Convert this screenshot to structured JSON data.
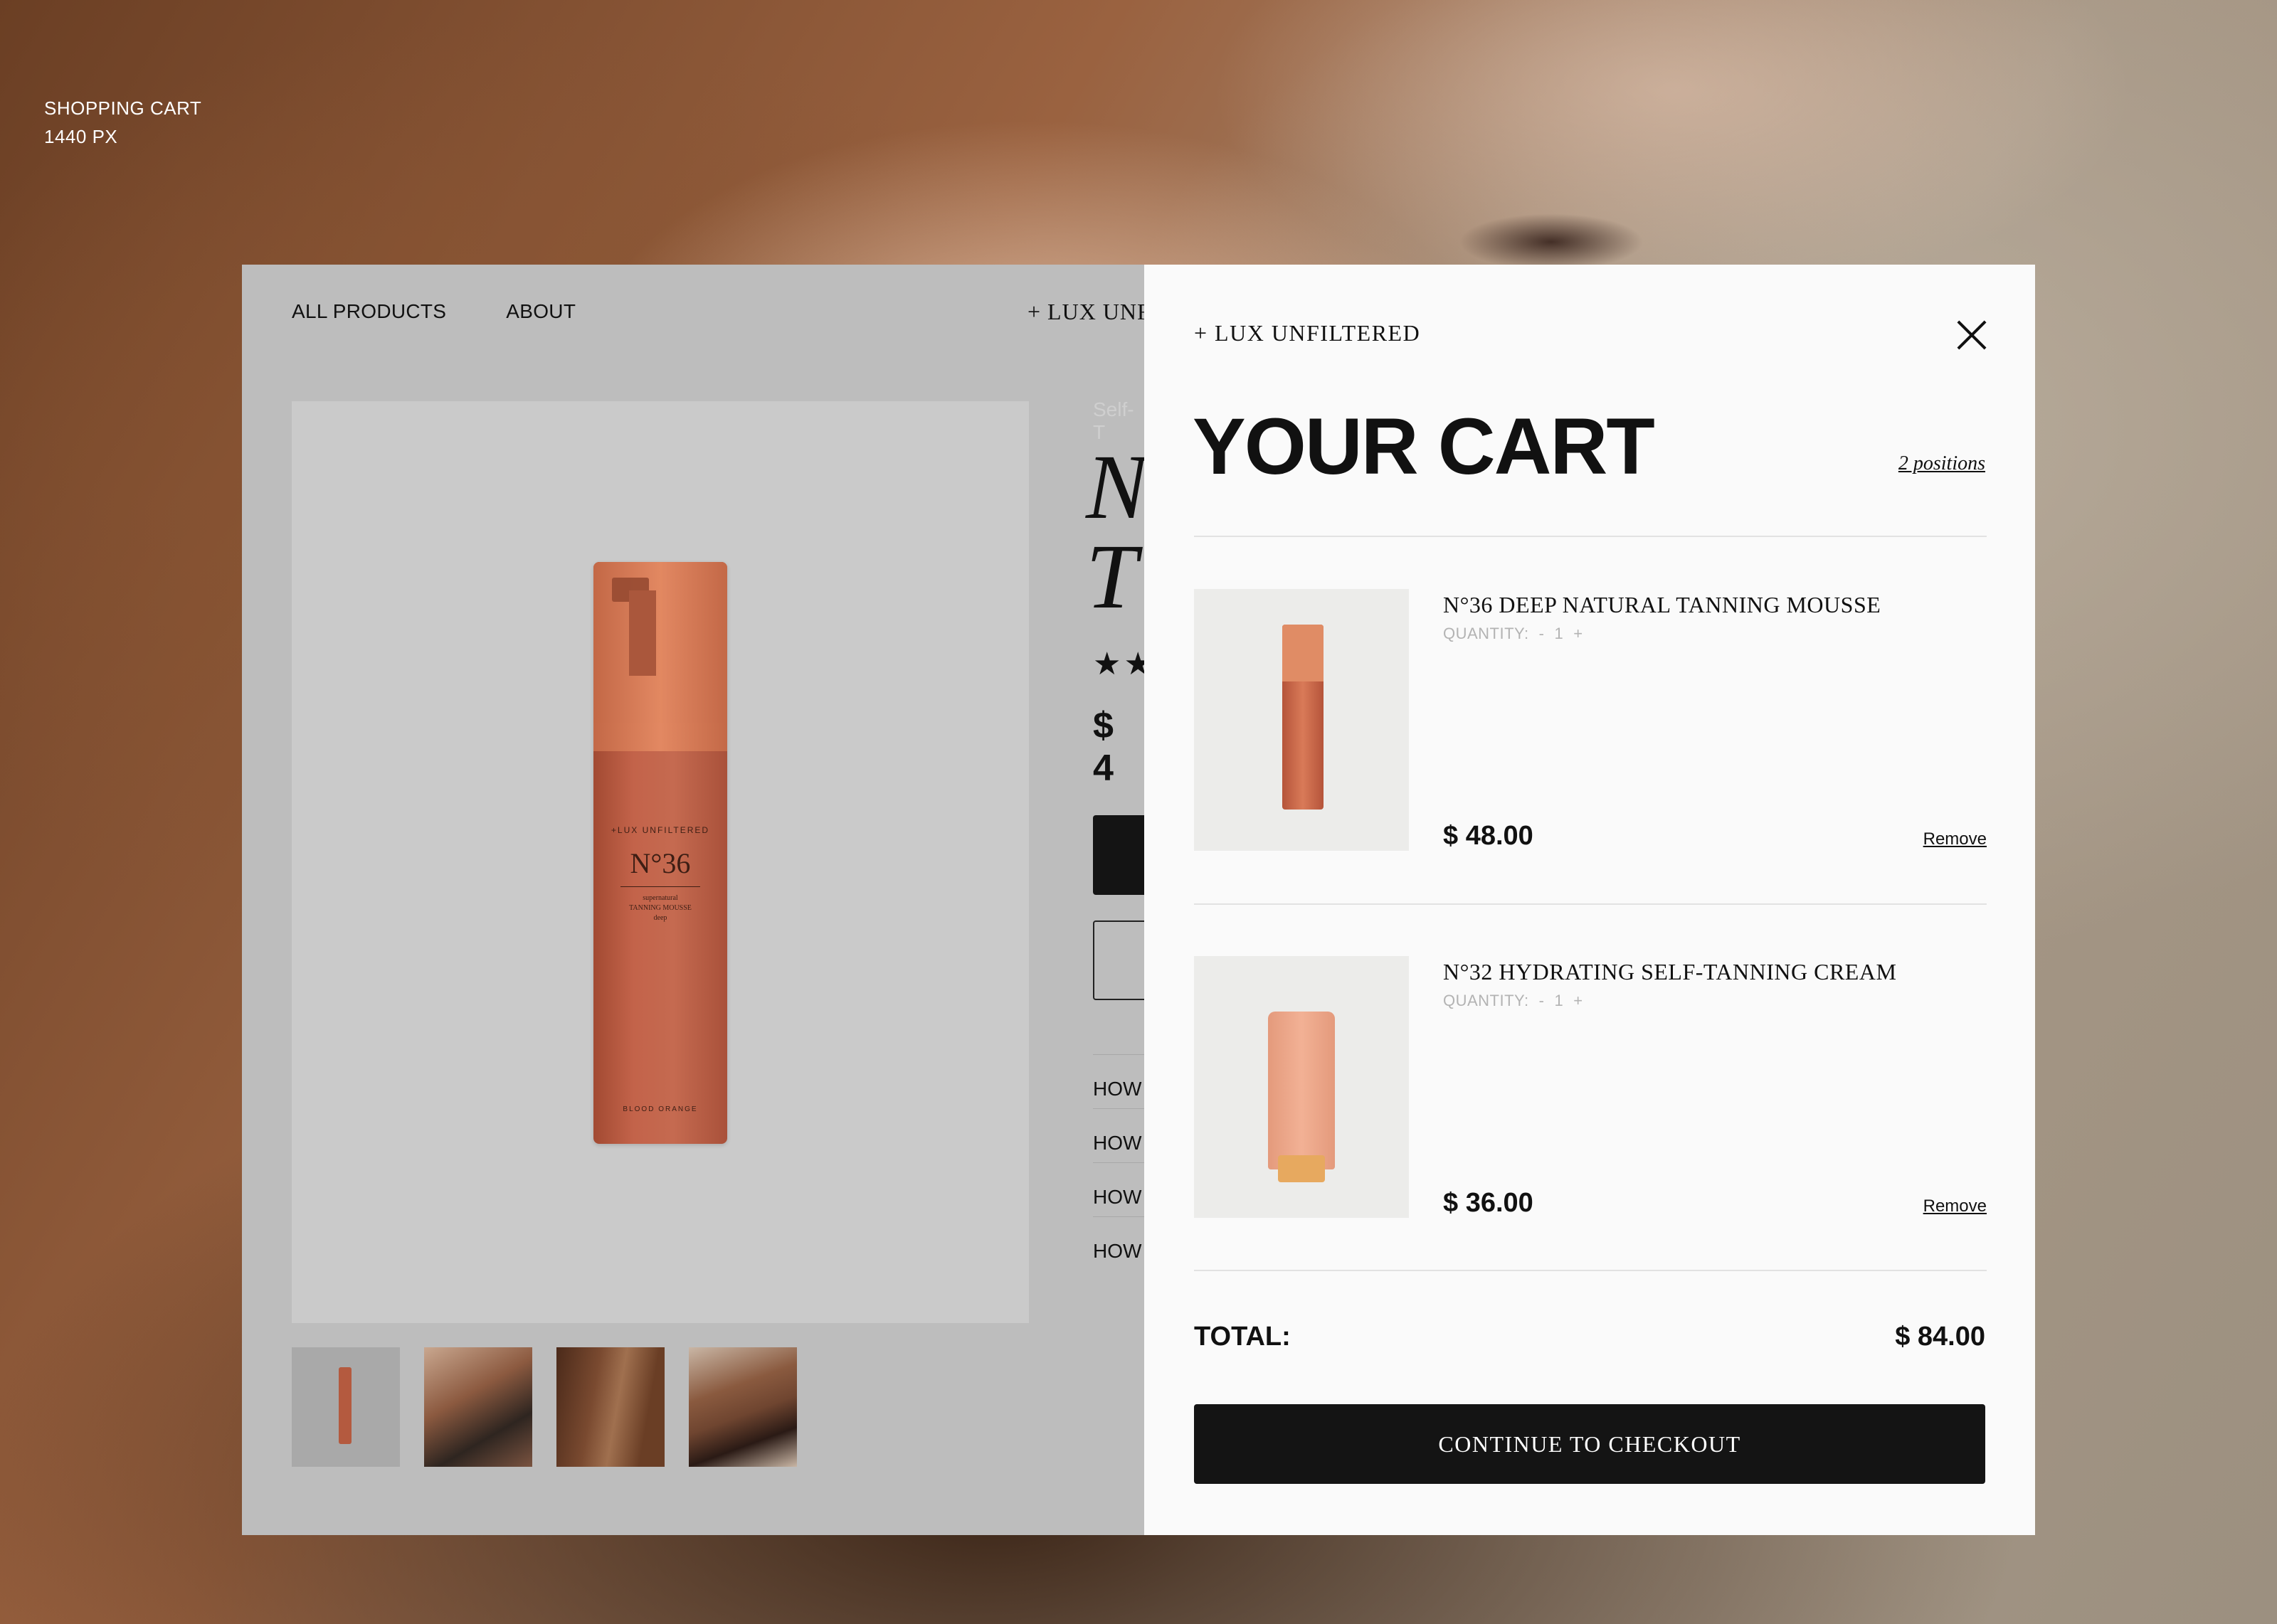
{
  "caption": {
    "line1": "SHOPPING CART",
    "line2": "1440 PX"
  },
  "page": {
    "nav": [
      "ALL PRODUCTS",
      "ABOUT"
    ],
    "brand": "+ LUX UNFILTERED",
    "product_image": {
      "brand": "+LUX UNFILTERED",
      "number": "N°36",
      "subtitle_1": "supernatural",
      "subtitle_2": "TANNING MOUSSE",
      "shade": "deep",
      "scent": "BLOOD ORANGE"
    },
    "peek": {
      "category": "Self-T",
      "title_line1": "N",
      "title_line2": "T",
      "stars": "★★",
      "price": "$ 4",
      "accordion": [
        "HOW",
        "HOW",
        "HOW",
        "HOW"
      ]
    }
  },
  "cart": {
    "brand": "+ LUX UNFILTERED",
    "title": "YOUR CART",
    "count": "2 positions",
    "qty_label": "QUANTITY:",
    "minus": "-",
    "plus": "+",
    "remove_label": "Remove",
    "items": [
      {
        "name": "N°36 DEEP NATURAL TANNING MOUSSE",
        "qty": "1",
        "price": "$ 48.00",
        "image": "tanning-mousse-bottle"
      },
      {
        "name": "N°32 HYDRATING SELF-TANNING CREAM",
        "qty": "1",
        "price": "$ 36.00",
        "image": "self-tanning-cream-tube"
      }
    ],
    "total_label": "TOTAL:",
    "total_value": "$ 84.00",
    "checkout_label": "CONTINUE TO CHECKOUT"
  },
  "colors": {
    "drawer_bg": "#fafafa",
    "button_dark": "#141414",
    "product_orange": "#c3634a",
    "muted_text": "#b3b3b3"
  }
}
